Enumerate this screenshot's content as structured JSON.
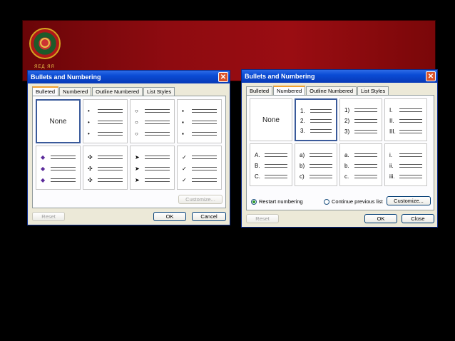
{
  "banner": {
    "seal_text": "ЯЕД ЯЯ"
  },
  "dialog_left": {
    "title": "Bullets and Numbering",
    "tabs": [
      "Bulleted",
      "Numbered",
      "Outline Numbered",
      "List Styles"
    ],
    "none_label": "None",
    "bullets": [
      "•",
      "○",
      "▪",
      "◆",
      "✣",
      "➤",
      "✓"
    ],
    "customize_label": "Customize...",
    "reset_label": "Reset",
    "ok_label": "OK",
    "cancel_label": "Cancel"
  },
  "dialog_right": {
    "title": "Bullets and Numbering",
    "tabs": [
      "Bulleted",
      "Numbered",
      "Outline Numbered",
      "List Styles"
    ],
    "none_label": "None",
    "styles": [
      [
        "1.",
        "2.",
        "3."
      ],
      [
        "1)",
        "2)",
        "3)"
      ],
      [
        "I.",
        "II.",
        "III."
      ],
      [
        "A.",
        "B.",
        "C."
      ],
      [
        "a)",
        "b)",
        "c)"
      ],
      [
        "a.",
        "b.",
        "c."
      ],
      [
        "i.",
        "ii.",
        "iii."
      ]
    ],
    "restart_label": "Restart numbering",
    "continue_label": "Continue previous list",
    "customize_label": "Customize...",
    "reset_label": "Reset",
    "ok_label": "OK",
    "close_label": "Close"
  }
}
